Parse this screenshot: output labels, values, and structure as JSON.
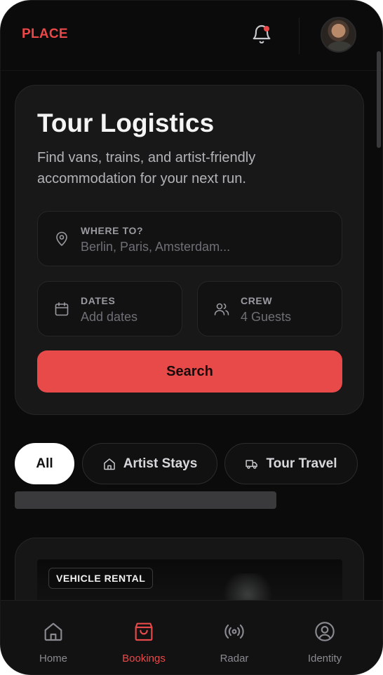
{
  "brand": "PLACE",
  "header": {
    "notification_icon": "bell-icon",
    "has_unread": true,
    "avatar": "user-avatar"
  },
  "hero": {
    "title": "Tour Logistics",
    "subtitle": "Find vans, trains, and artist-friendly accommodation for your next run."
  },
  "search": {
    "where": {
      "label": "WHERE TO?",
      "placeholder": "Berlin, Paris, Amsterdam...",
      "icon": "map-pin-icon"
    },
    "dates": {
      "label": "DATES",
      "placeholder": "Add dates",
      "icon": "calendar-icon"
    },
    "crew": {
      "label": "CREW",
      "value": "4 Guests",
      "icon": "users-icon"
    },
    "button_label": "Search"
  },
  "filters": [
    {
      "label": "All",
      "selected": true
    },
    {
      "label": "Artist Stays",
      "icon": "home-icon",
      "selected": false
    },
    {
      "label": "Tour Travel",
      "icon": "truck-icon",
      "selected": false
    }
  ],
  "listing": {
    "badge": "VEHICLE RENTAL"
  },
  "nav": [
    {
      "label": "Home",
      "icon": "home-icon",
      "active": false
    },
    {
      "label": "Bookings",
      "icon": "shopping-bag-icon",
      "active": true
    },
    {
      "label": "Radar",
      "icon": "radar-icon",
      "active": false
    },
    {
      "label": "Identity",
      "icon": "user-circle-icon",
      "active": false
    }
  ],
  "colors": {
    "accent": "#e84a4a",
    "background": "#0b0b0c",
    "card": "#181819"
  }
}
